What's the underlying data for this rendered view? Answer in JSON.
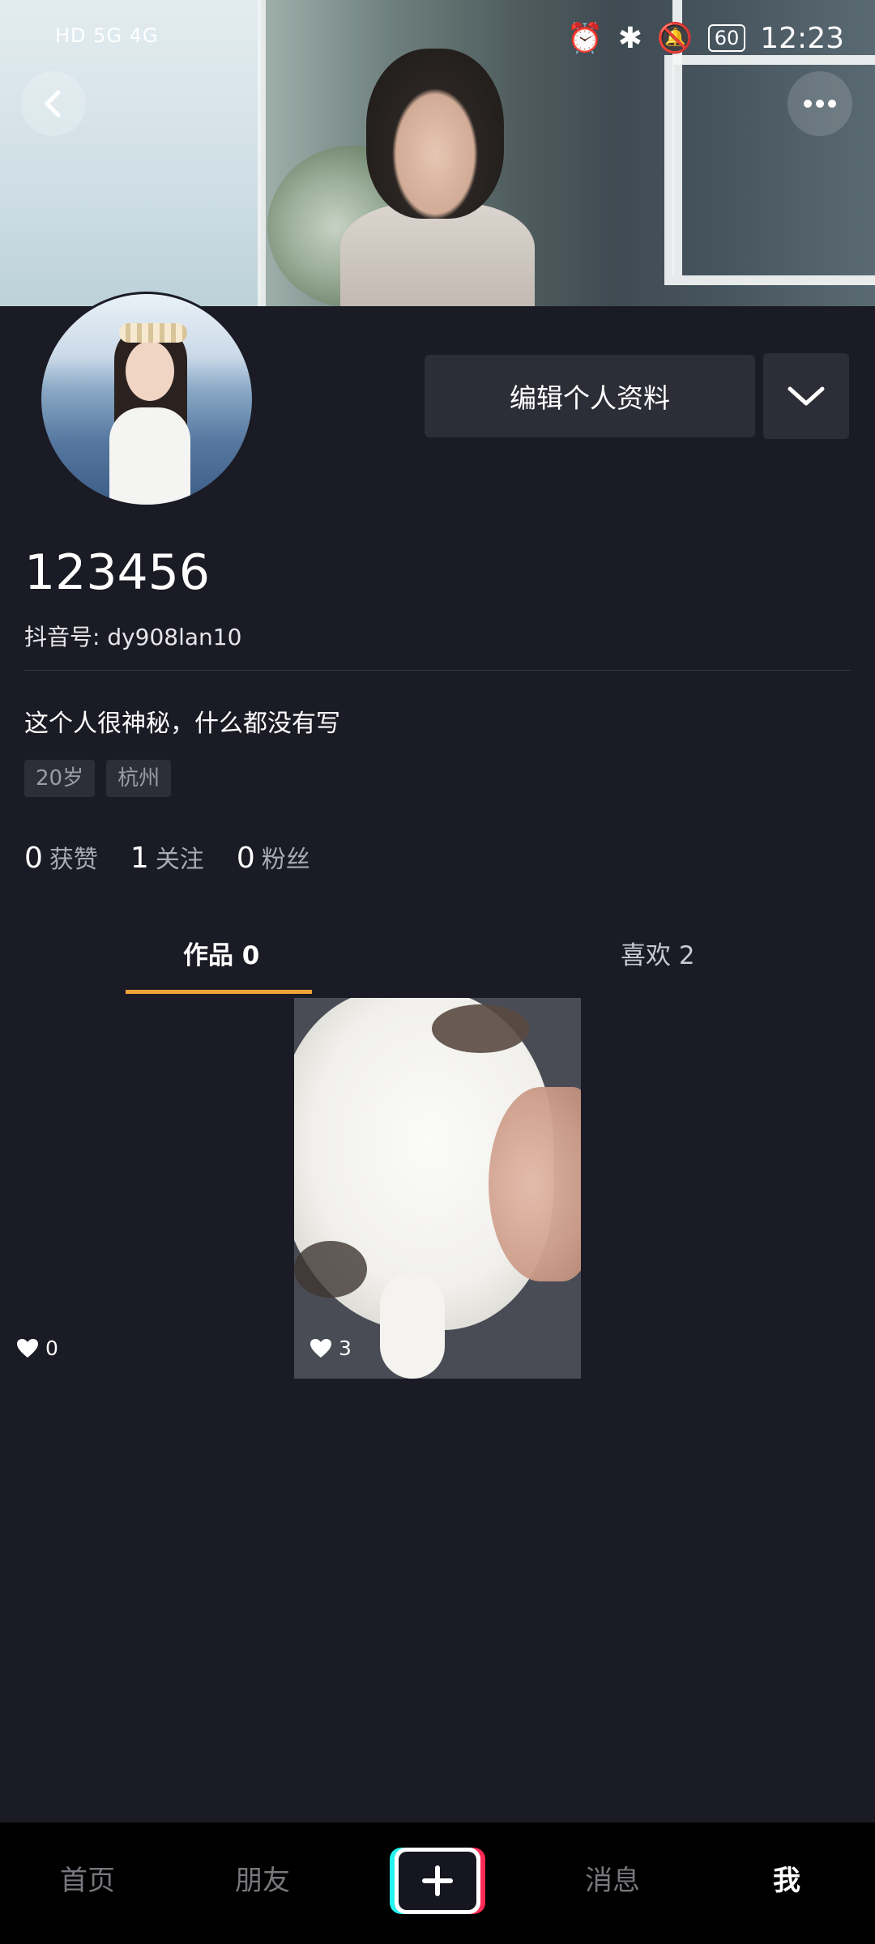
{
  "status_bar": {
    "left_indicators": "HD 5G 4G",
    "battery": "60",
    "time": "12:23"
  },
  "profile": {
    "username": "123456",
    "douyin_id": "抖音号: dy908lan10",
    "bio": "这个人很神秘，什么都没有写",
    "tags": [
      "20岁",
      "杭州"
    ],
    "edit_button": "编辑个人资料"
  },
  "stats": [
    {
      "count": "0",
      "label": "获赞"
    },
    {
      "count": "1",
      "label": "关注"
    },
    {
      "count": "0",
      "label": "粉丝"
    }
  ],
  "tabs": {
    "works": "作品 0",
    "likes": "喜欢 2"
  },
  "grid": [
    {
      "likes": "0"
    },
    {
      "likes": "3"
    }
  ],
  "bottom_nav": {
    "home": "首页",
    "friends": "朋友",
    "messages": "消息",
    "me": "我"
  },
  "colors": {
    "background": "#1b1b25",
    "accent_underline": "#f1a33a",
    "button_bg": "#2c2d37"
  }
}
